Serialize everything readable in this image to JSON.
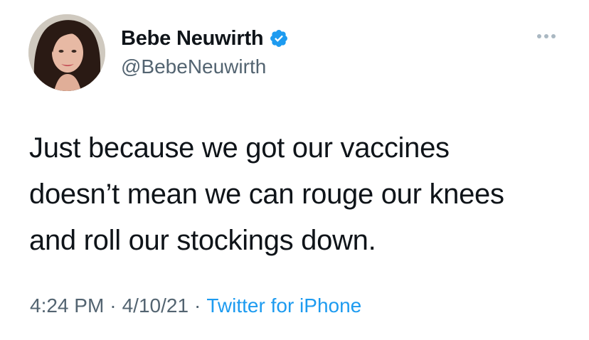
{
  "author": {
    "display_name": "Bebe Neuwirth",
    "handle": "@BebeNeuwirth",
    "verified": true,
    "verified_icon": "verified-badge-icon",
    "avatar_icon": "profile-photo"
  },
  "menu": {
    "more_icon": "more-options-icon"
  },
  "tweet": {
    "lines": [
      "Just because we got our vaccines",
      "doesn’t mean we can rouge our knees",
      "and roll our stockings down."
    ]
  },
  "meta": {
    "time": "4:24 PM",
    "separator": "·",
    "date": "4/10/21",
    "source": "Twitter for iPhone"
  },
  "colors": {
    "text": "#0f1419",
    "secondary": "#536471",
    "accent": "#1d9bf0"
  }
}
